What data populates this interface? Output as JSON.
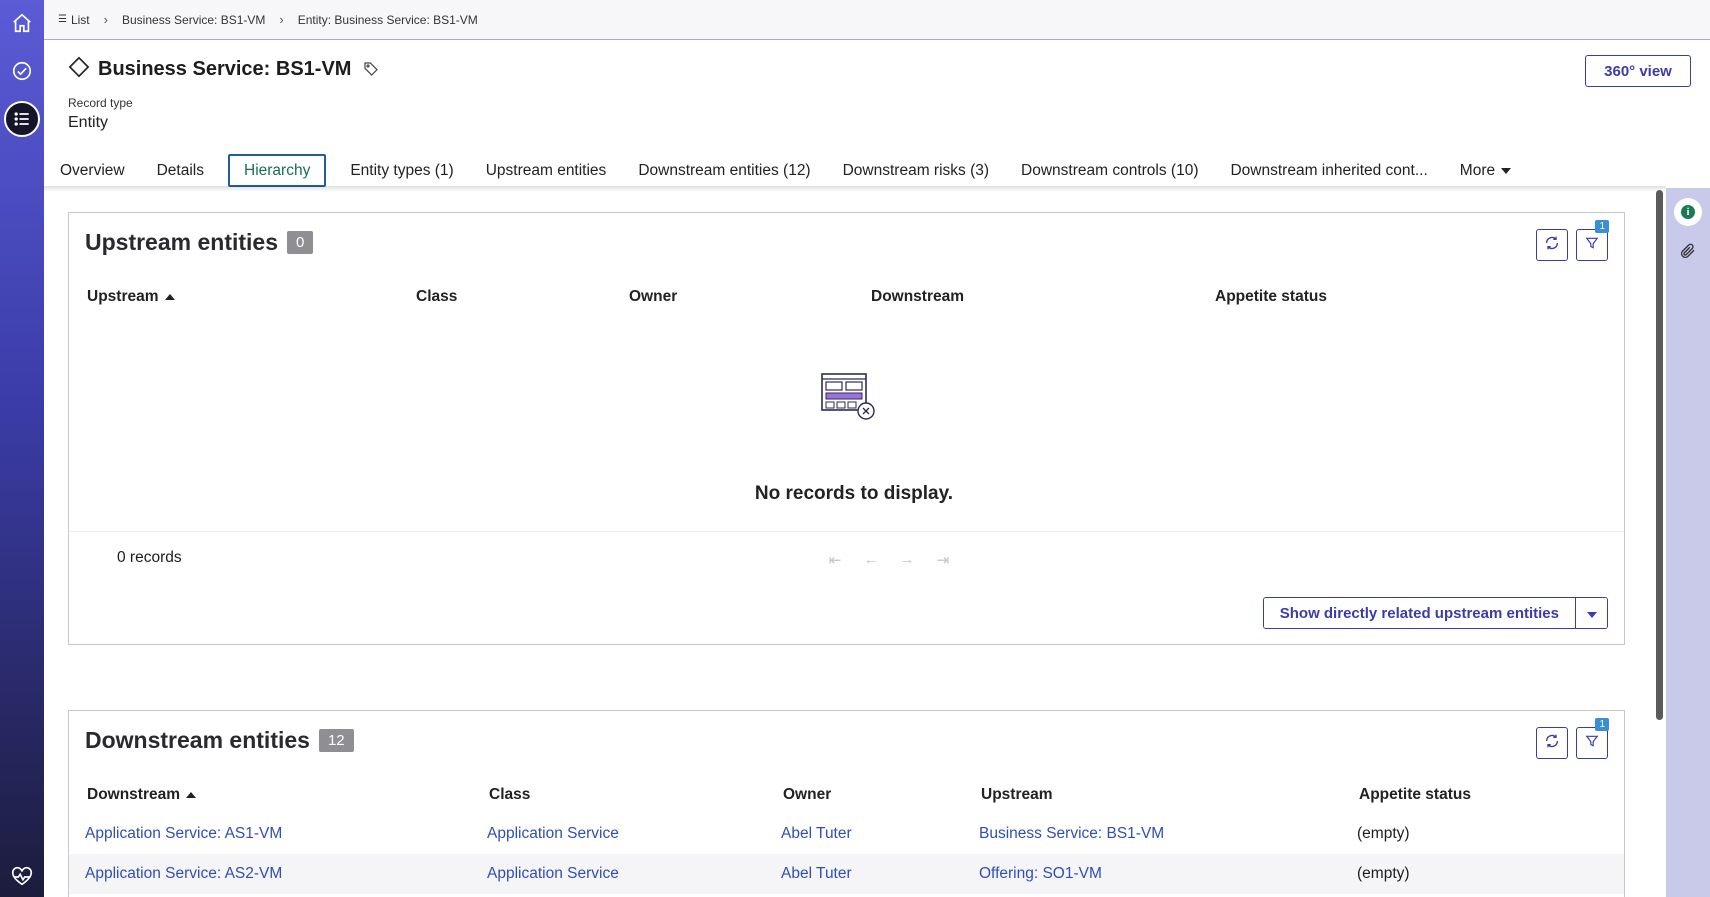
{
  "breadcrumb": {
    "items": [
      {
        "label": "List"
      },
      {
        "label": "Business Service: BS1-VM"
      },
      {
        "label": "Entity: Business Service: BS1-VM"
      }
    ]
  },
  "header": {
    "title": "Business Service: BS1-VM",
    "record_type_label": "Record type",
    "record_type_value": "Entity",
    "view360_label": "360° view"
  },
  "tabs": [
    {
      "label": "Overview"
    },
    {
      "label": "Details"
    },
    {
      "label": "Hierarchy"
    },
    {
      "label": "Entity types (1)"
    },
    {
      "label": "Upstream entities"
    },
    {
      "label": "Downstream entities (12)"
    },
    {
      "label": "Downstream risks (3)"
    },
    {
      "label": "Downstream controls (10)"
    },
    {
      "label": "Downstream inherited cont..."
    },
    {
      "label": "More"
    }
  ],
  "upstream_panel": {
    "title": "Upstream entities",
    "count": "0",
    "filter_count": "1",
    "columns": [
      "Upstream",
      "Class",
      "Owner",
      "Downstream",
      "Appetite status"
    ],
    "empty_text": "No records to display.",
    "records_text": "0 records",
    "show_button": "Show directly related upstream entities"
  },
  "downstream_panel": {
    "title": "Downstream entities",
    "count": "12",
    "filter_count": "1",
    "columns": [
      "Downstream",
      "Class",
      "Owner",
      "Upstream",
      "Appetite status"
    ],
    "rows": [
      [
        "Application Service: AS1-VM",
        "Application Service",
        "Abel Tuter",
        "Business Service: BS1-VM",
        "(empty)"
      ],
      [
        "Application Service: AS2-VM",
        "Application Service",
        "Abel Tuter",
        "Offering: SO1-VM",
        "(empty)"
      ]
    ]
  },
  "colors": {
    "accent": "#3b3ca8",
    "link": "#2f4fb5",
    "active_tab_border": "#1e5fa0",
    "active_tab_text": "#1a6e57",
    "badge": "#8e8e93"
  },
  "icons": {
    "rail": [
      "home-icon",
      "check-circle-icon",
      "list-icon",
      "activity-heart-icon"
    ],
    "header": [
      "diamond-icon",
      "tag-icon"
    ],
    "panel": [
      "refresh-icon",
      "filter-icon"
    ],
    "pager": [
      "first-page-icon",
      "prev-page-icon",
      "next-page-icon",
      "last-page-icon"
    ],
    "right_rail": [
      "info-icon",
      "paperclip-icon"
    ]
  }
}
